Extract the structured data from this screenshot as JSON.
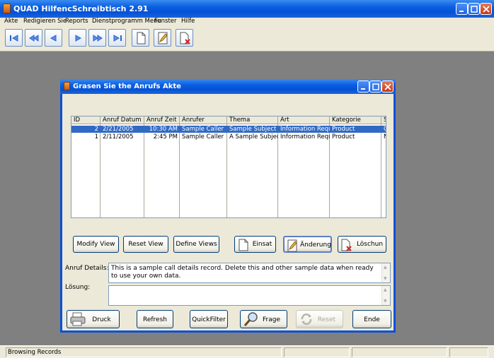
{
  "app": {
    "title": "QUAD HilfencSchreibtisch 2.91"
  },
  "menu": [
    "Akte",
    "Redigieren Sie",
    "Reports",
    "Dienstprogramm Menu",
    "Fenster",
    "Hilfe"
  ],
  "toolbar_icons": [
    "first-record-icon",
    "prev-page-icon",
    "prev-record-icon",
    "next-record-icon",
    "next-page-icon",
    "last-record-icon",
    "new-document-icon",
    "edit-document-icon",
    "delete-document-icon"
  ],
  "dialog": {
    "title": "Grasen Sie the Anrufs Akte",
    "columns": [
      "ID",
      "Anruf Datum",
      "Anruf Zeit",
      "Anrufer",
      "Thema",
      "Art",
      "Kategorie",
      "S"
    ],
    "rows": [
      [
        "2",
        "2/21/2005",
        "10:30 AM",
        "Sample Caller",
        "Sample Subject",
        "Information Request",
        "Product",
        "C"
      ],
      [
        "1",
        "2/11/2005",
        "2:45 PM",
        "Sample Caller",
        "A Sample Subject",
        "Information Request",
        "Product",
        "N"
      ]
    ],
    "view_buttons": {
      "modify": "Modify View",
      "reset": "Reset View",
      "define": "Define Views"
    },
    "record_buttons": {
      "insert": "Einsat",
      "change": "Änderung",
      "delete": "Löschun"
    },
    "details_label": "Anruf Details:",
    "details_value": "This is a sample call details record.  Delete this and other sample data when ready to use your own data.",
    "solution_label": "Lösung:",
    "solution_value": "",
    "bottom_buttons": {
      "print": "Druck",
      "refresh": "Refresh",
      "quickfilter": "QuickFilter",
      "query": "Frage",
      "reset": "Reset",
      "end": "Ende"
    }
  },
  "status": {
    "text": "Browsing Records"
  },
  "colors": {
    "titlebar": "#0a5ee0",
    "selection": "#316ac5",
    "face": "#ece9d8",
    "desktop": "#808080"
  }
}
